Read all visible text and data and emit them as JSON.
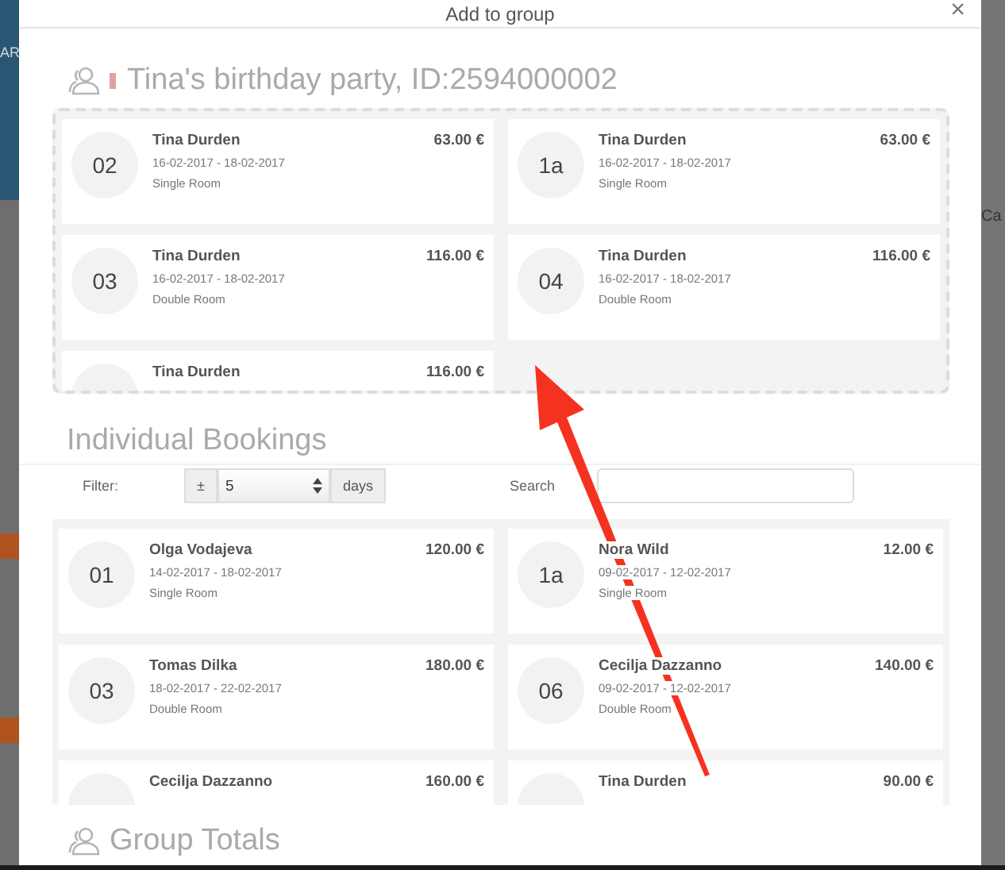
{
  "background": {
    "left_text": "AR",
    "right_text": "Ca"
  },
  "dialog": {
    "title": "Add to group",
    "close": "×"
  },
  "group": {
    "title": "Tina's birthday party, ID:2594000002",
    "bookings": [
      {
        "room": "02",
        "name": "Tina Durden",
        "dates": "16-02-2017 - 18-02-2017",
        "type": "Single Room",
        "price": "63.00 €"
      },
      {
        "room": "1a",
        "name": "Tina Durden",
        "dates": "16-02-2017 - 18-02-2017",
        "type": "Single Room",
        "price": "63.00 €"
      },
      {
        "room": "03",
        "name": "Tina Durden",
        "dates": "16-02-2017 - 18-02-2017",
        "type": "Double Room",
        "price": "116.00 €"
      },
      {
        "room": "04",
        "name": "Tina Durden",
        "dates": "16-02-2017 - 18-02-2017",
        "type": "Double Room",
        "price": "116.00 €"
      },
      {
        "name": "Tina Durden",
        "price": "116.00 €"
      }
    ]
  },
  "individual": {
    "title": "Individual Bookings",
    "filter": {
      "label": "Filter:",
      "prefix": "±",
      "value": "5",
      "unit": "days"
    },
    "search": {
      "label": "Search"
    },
    "bookings": [
      {
        "room": "01",
        "name": "Olga Vodajeva",
        "dates": "14-02-2017 - 18-02-2017",
        "type": "Single Room",
        "price": "120.00 €"
      },
      {
        "room": "1a",
        "name": "Nora Wild",
        "dates": "09-02-2017 - 12-02-2017",
        "type": "Single Room",
        "price": "12.00 €"
      },
      {
        "room": "03",
        "name": "Tomas Dilka",
        "dates": "18-02-2017 - 22-02-2017",
        "type": "Double Room",
        "price": "180.00 €"
      },
      {
        "room": "06",
        "name": "Cecilja Dazzanno",
        "dates": "09-02-2017 - 12-02-2017",
        "type": "Double Room",
        "price": "140.00 €"
      },
      {
        "name": "Cecilja Dazzanno",
        "price": "160.00 €"
      },
      {
        "name": "Tina Durden",
        "price": "90.00 €"
      }
    ]
  },
  "totals": {
    "title": "Group Totals"
  }
}
